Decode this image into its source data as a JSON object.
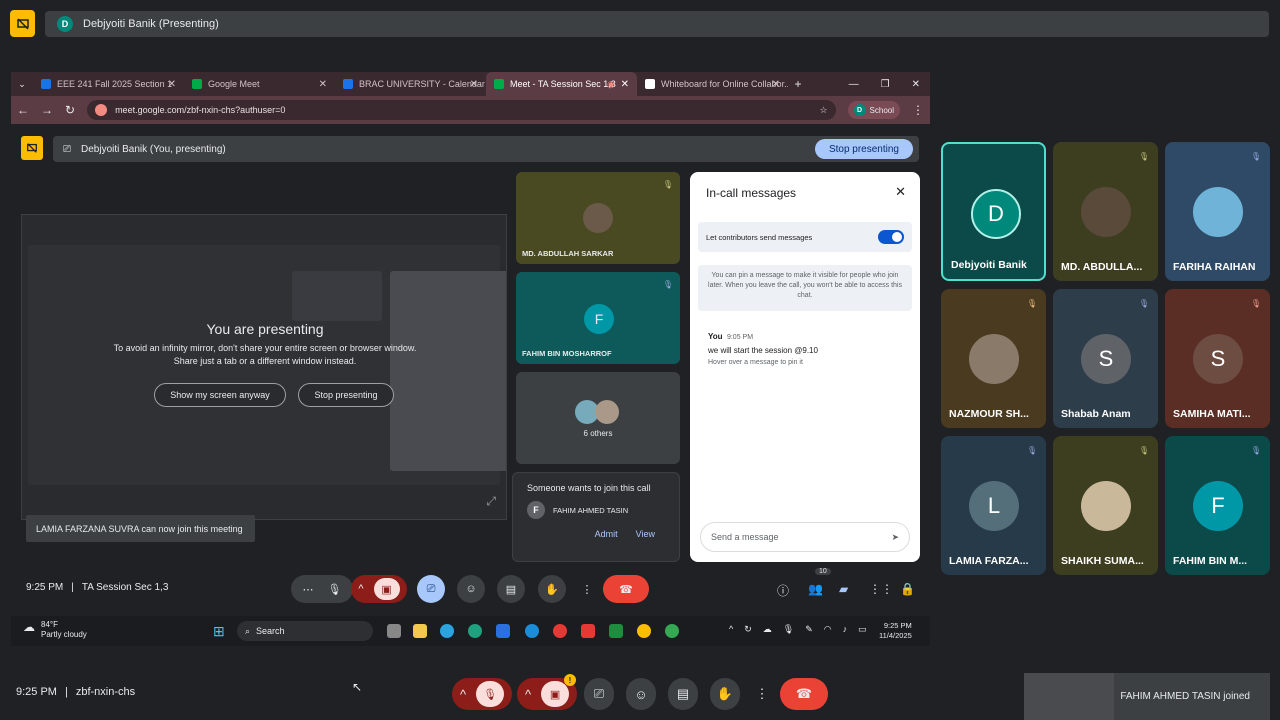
{
  "outer_banner": {
    "avatar": "D",
    "text": "Debjyoiti Banik (Presenting)"
  },
  "browser": {
    "tabs": [
      {
        "label": "EEE 241 Fall 2025 Section 1",
        "color": "#1a73e8"
      },
      {
        "label": "Google Meet",
        "color": "#00ac47"
      },
      {
        "label": "BRAC UNIVERSITY - Calendar",
        "color": "#1a73e8"
      },
      {
        "label": "Meet - TA Session Sec 1,3",
        "color": "#00ac47"
      },
      {
        "label": "Whiteboard for Online Collabor...",
        "color": "#ffffff"
      }
    ],
    "new_tab": "+",
    "url": "meet.google.com/zbf-nxin-chs?authuser=0",
    "profile_initial": "D",
    "profile_label": "School"
  },
  "inner": {
    "banner_text": "Debjyoiti Banik (You, presenting)",
    "stop_presenting": "Stop presenting",
    "presenting_title": "You are presenting",
    "presenting_msg1": "To avoid an infinity mirror, don't share your entire screen or browser window.",
    "presenting_msg2": "Share just a tab or a different window instead.",
    "show_anyway": "Show my screen anyway",
    "stop_btn": "Stop presenting",
    "toast": "LAMIA FARZANA SUVRA can now join this meeting",
    "tiles": [
      {
        "name": "MD. ABDULLAH SARKAR"
      },
      {
        "name": "FAHIM BIN MOSHARROF",
        "initial": "F"
      },
      {
        "name": "6 others"
      }
    ],
    "join": {
      "title": "Someone wants to join this call",
      "initial": "F",
      "person": "FAHIM AHMED TASIN",
      "admit": "Admit",
      "view": "View"
    },
    "chat": {
      "title": "In-call messages",
      "toggle_label": "Let contributors send messages",
      "pin_info": "You can pin a message to make it visible for people who join later. When you leave the call, you won't be able to access this chat.",
      "sender": "You",
      "time": "9:05 PM",
      "message": "we will start the session @9.10",
      "hover_hint": "Hover over a message to pin it",
      "placeholder": "Send a message"
    },
    "footer": {
      "time": "9:25 PM",
      "meeting": "TA Session Sec 1,3",
      "people_count": "10"
    },
    "taskbar": {
      "temp": "84°F",
      "weather": "Partly cloudy",
      "search": "Search",
      "clock_time": "9:25 PM",
      "clock_date": "11/4/2025"
    }
  },
  "grid": [
    {
      "name": "Debjyoiti Banik",
      "initial": "D",
      "bg": "#0c4a4a",
      "av": "#00897b"
    },
    {
      "name": "MD. ABDULLA...",
      "bg": "#3d3d1f"
    },
    {
      "name": "FARIHA RAIHAN",
      "bg": "#2e4a66"
    },
    {
      "name": "NAZMOUR SH...",
      "bg": "#4a3a20"
    },
    {
      "name": "Shabab Anam",
      "initial": "S",
      "bg": "#2e3d4a",
      "av": "#5f6368"
    },
    {
      "name": "SAMIHA MATI...",
      "initial": "S",
      "bg": "#5a2e24",
      "av": "#6d4c41"
    },
    {
      "name": "LAMIA FARZA...",
      "initial": "L",
      "bg": "#263a4a",
      "av": "#546e7a"
    },
    {
      "name": "SHAIKH SUMA...",
      "bg": "#3d3d1f"
    },
    {
      "name": "FAHIM BIN M...",
      "initial": "F",
      "bg": "#0c4a4a",
      "av": "#0097a7"
    }
  ],
  "bottom": {
    "time": "9:25 PM",
    "code": "zbf-nxin-chs",
    "joined": "FAHIM AHMED TASIN joined"
  }
}
